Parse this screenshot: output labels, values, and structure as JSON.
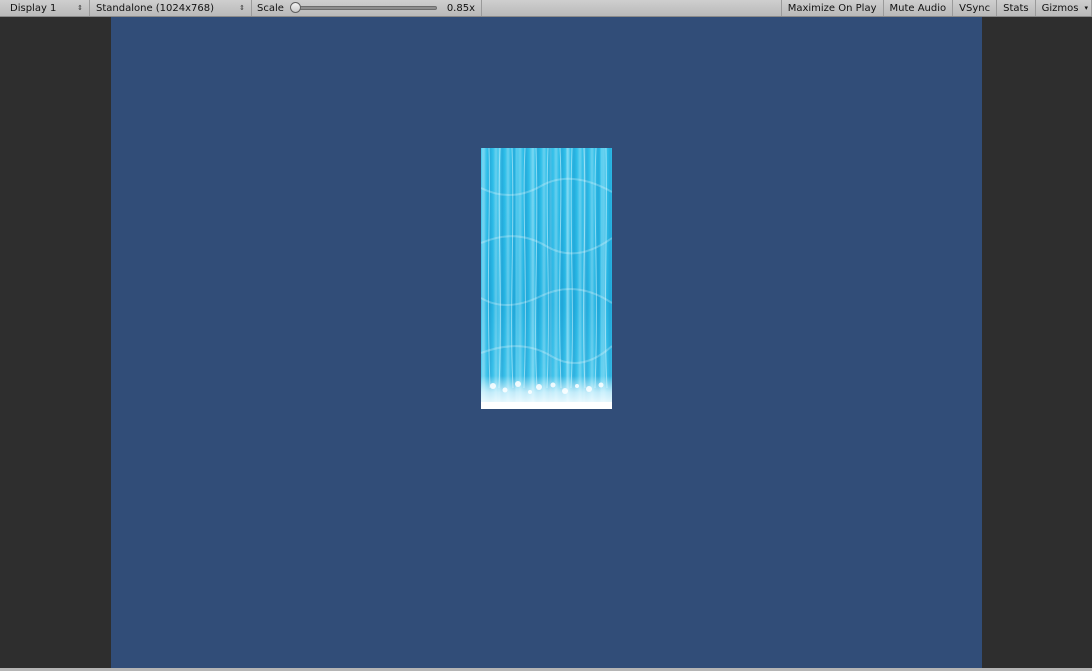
{
  "toolbar": {
    "display": "Display 1",
    "resolution": "Standalone (1024x768)",
    "scale_label": "Scale",
    "scale_value": "0.85x",
    "maximize_on_play": "Maximize On Play",
    "mute_audio": "Mute Audio",
    "vsync": "VSync",
    "stats": "Stats",
    "gizmos": "Gizmos",
    "arrow_glyph": "▾",
    "updown_glyph": "⇕"
  },
  "colors": {
    "toolbar_bg": "#c2c2c2",
    "viewport_bg": "#314d78",
    "letterbox": "#2e2e2e",
    "water": "#2fc0ea"
  },
  "scene": {
    "object": "waterfall-sprite"
  }
}
